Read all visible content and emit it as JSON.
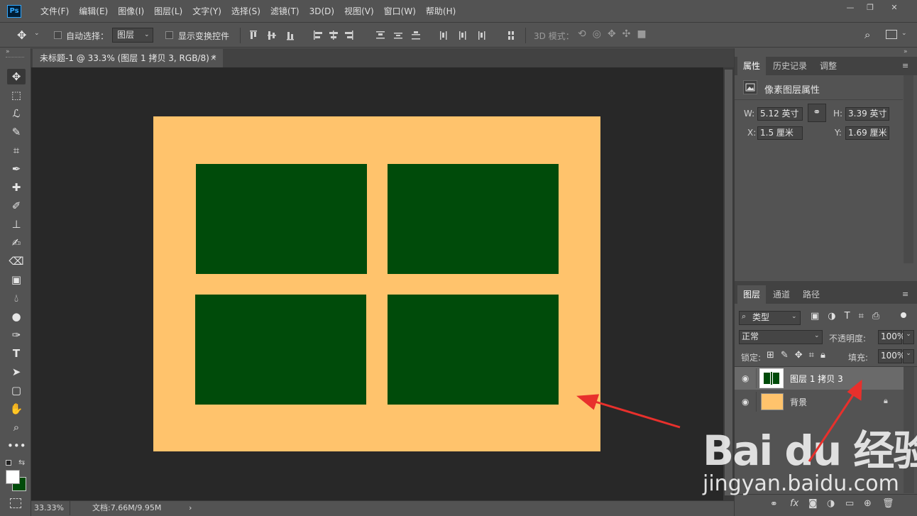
{
  "app": {
    "logo": "Ps"
  },
  "menu": [
    "文件(F)",
    "编辑(E)",
    "图像(I)",
    "图层(L)",
    "文字(Y)",
    "选择(S)",
    "滤镜(T)",
    "3D(D)",
    "视图(V)",
    "窗口(W)",
    "帮助(H)"
  ],
  "window_controls": {
    "minimize": "—",
    "restore": "❐",
    "close": "✕"
  },
  "options_bar": {
    "auto_select_label": "自动选择：",
    "auto_select_target": "图层",
    "show_transform_label": "显示变换控件",
    "mode_3d_label": "3D 模式："
  },
  "document_tab": {
    "title": "未标题-1 @ 33.3% (图层 1 拷贝 3, RGB/8) *",
    "close": "×"
  },
  "status": {
    "zoom": "33.33%",
    "doc_info": "文档:7.66M/9.95M",
    "arrow": "›"
  },
  "document": {
    "background_color": "#ffc36c",
    "rect_color": "#004b0a"
  },
  "properties_panel": {
    "tabs": [
      "属性",
      "历史记录",
      "调整"
    ],
    "section_title": "像素图层属性",
    "w_label": "W:",
    "w_value": "5.12 英寸",
    "h_label": "H:",
    "h_value": "3.39 英寸",
    "x_label": "X:",
    "x_value": "1.5 厘米",
    "y_label": "Y:",
    "y_value": "1.69 厘米"
  },
  "layers_panel": {
    "tabs": [
      "图层",
      "通道",
      "路径"
    ],
    "filter_kind": "类型",
    "blend_mode": "正常",
    "opacity_label": "不透明度:",
    "opacity_value": "100%",
    "lock_label": "锁定:",
    "fill_label": "填充:",
    "fill_value": "100%",
    "layers": [
      {
        "name": "图层 1 拷贝 3",
        "selected": true
      },
      {
        "name": "背景",
        "selected": false,
        "locked": true
      }
    ]
  },
  "watermark": {
    "logo_text": "Bai du 经验",
    "url": "jingyan.baidu.com"
  },
  "annotation_colors": {
    "arrow": "#e8302c"
  }
}
